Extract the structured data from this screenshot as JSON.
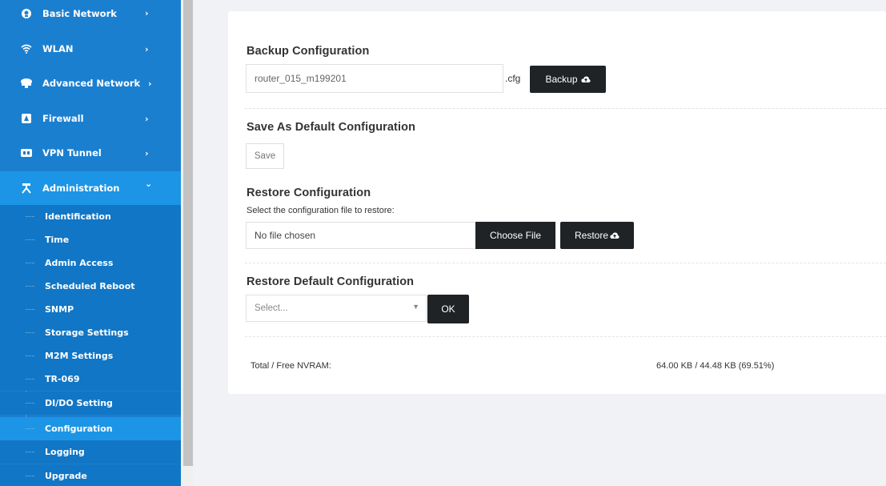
{
  "sidebar": {
    "items": [
      {
        "label": "Basic Network",
        "icon": "globe-icon"
      },
      {
        "label": "WLAN",
        "icon": "wifi-icon"
      },
      {
        "label": "Advanced Network",
        "icon": "network-icon"
      },
      {
        "label": "Firewall",
        "icon": "firewall-icon"
      },
      {
        "label": "VPN Tunnel",
        "icon": "vpn-icon"
      },
      {
        "label": "Administration",
        "icon": "admin-icon"
      }
    ],
    "sub_items": [
      "Identification",
      "Time",
      "Admin Access",
      "Scheduled Reboot",
      "SNMP",
      "Storage Settings",
      "M2M Settings",
      "TR-069",
      "DI/DO Setting",
      "Configuration",
      "Logging",
      "Upgrade"
    ],
    "chevron_right": "›",
    "chevron_down": "⌄"
  },
  "backup": {
    "title": "Backup Configuration",
    "filename": "router_015_m199201",
    "ext": ".cfg",
    "button": "Backup"
  },
  "save_default": {
    "title": "Save As Default Configuration",
    "button": "Save"
  },
  "restore": {
    "title": "Restore Configuration",
    "hint": "Select the configuration file to restore:",
    "file_status": "No file chosen",
    "choose_button": "Choose File",
    "restore_button": "Restore"
  },
  "restore_default": {
    "title": "Restore Default Configuration",
    "select_placeholder": "Select...",
    "ok_button": "OK"
  },
  "nvram": {
    "label": "Total / Free NVRAM:",
    "value": "64.00 KB / 44.48 KB (69.51%)"
  },
  "colors": {
    "sidebar": "#1b7fd0",
    "active": "#1c95e6",
    "button_dark": "#1f2326"
  }
}
